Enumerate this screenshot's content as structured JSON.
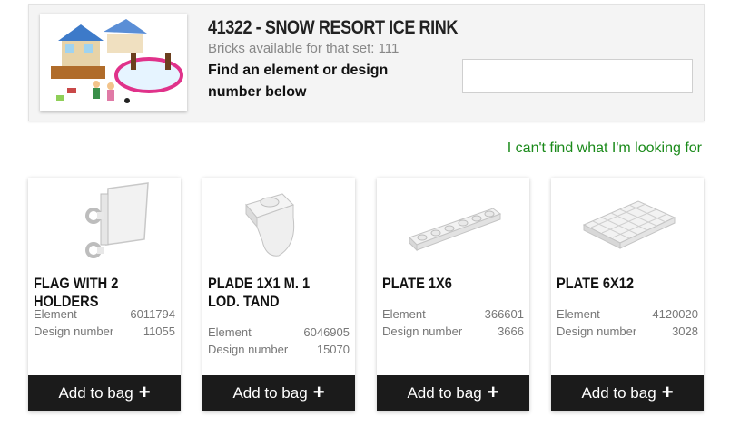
{
  "set": {
    "title": "41322 - SNOW RESORT ICE RINK",
    "subtitle": "Bricks available for that set: 111",
    "find_label": "Find an element or design number below",
    "search_value": ""
  },
  "cant_find_link": "I can't find what I'm looking for",
  "labels": {
    "element": "Element",
    "design": "Design number",
    "add": "Add to bag"
  },
  "icons": {
    "plus": "+"
  },
  "products": [
    {
      "title": "FLAG WITH 2 HOLDERS",
      "element": "6011794",
      "design": "11055"
    },
    {
      "title": "PLADE 1X1 M. 1 LOD. TAND",
      "element": "6046905",
      "design": "15070"
    },
    {
      "title": "PLATE 1X6",
      "element": "366601",
      "design": "3666"
    },
    {
      "title": "PLATE 6X12",
      "element": "4120020",
      "design": "3028"
    }
  ],
  "colors": {
    "accent_green": "#1a8a1a",
    "button_dark": "#1b1b1b"
  }
}
